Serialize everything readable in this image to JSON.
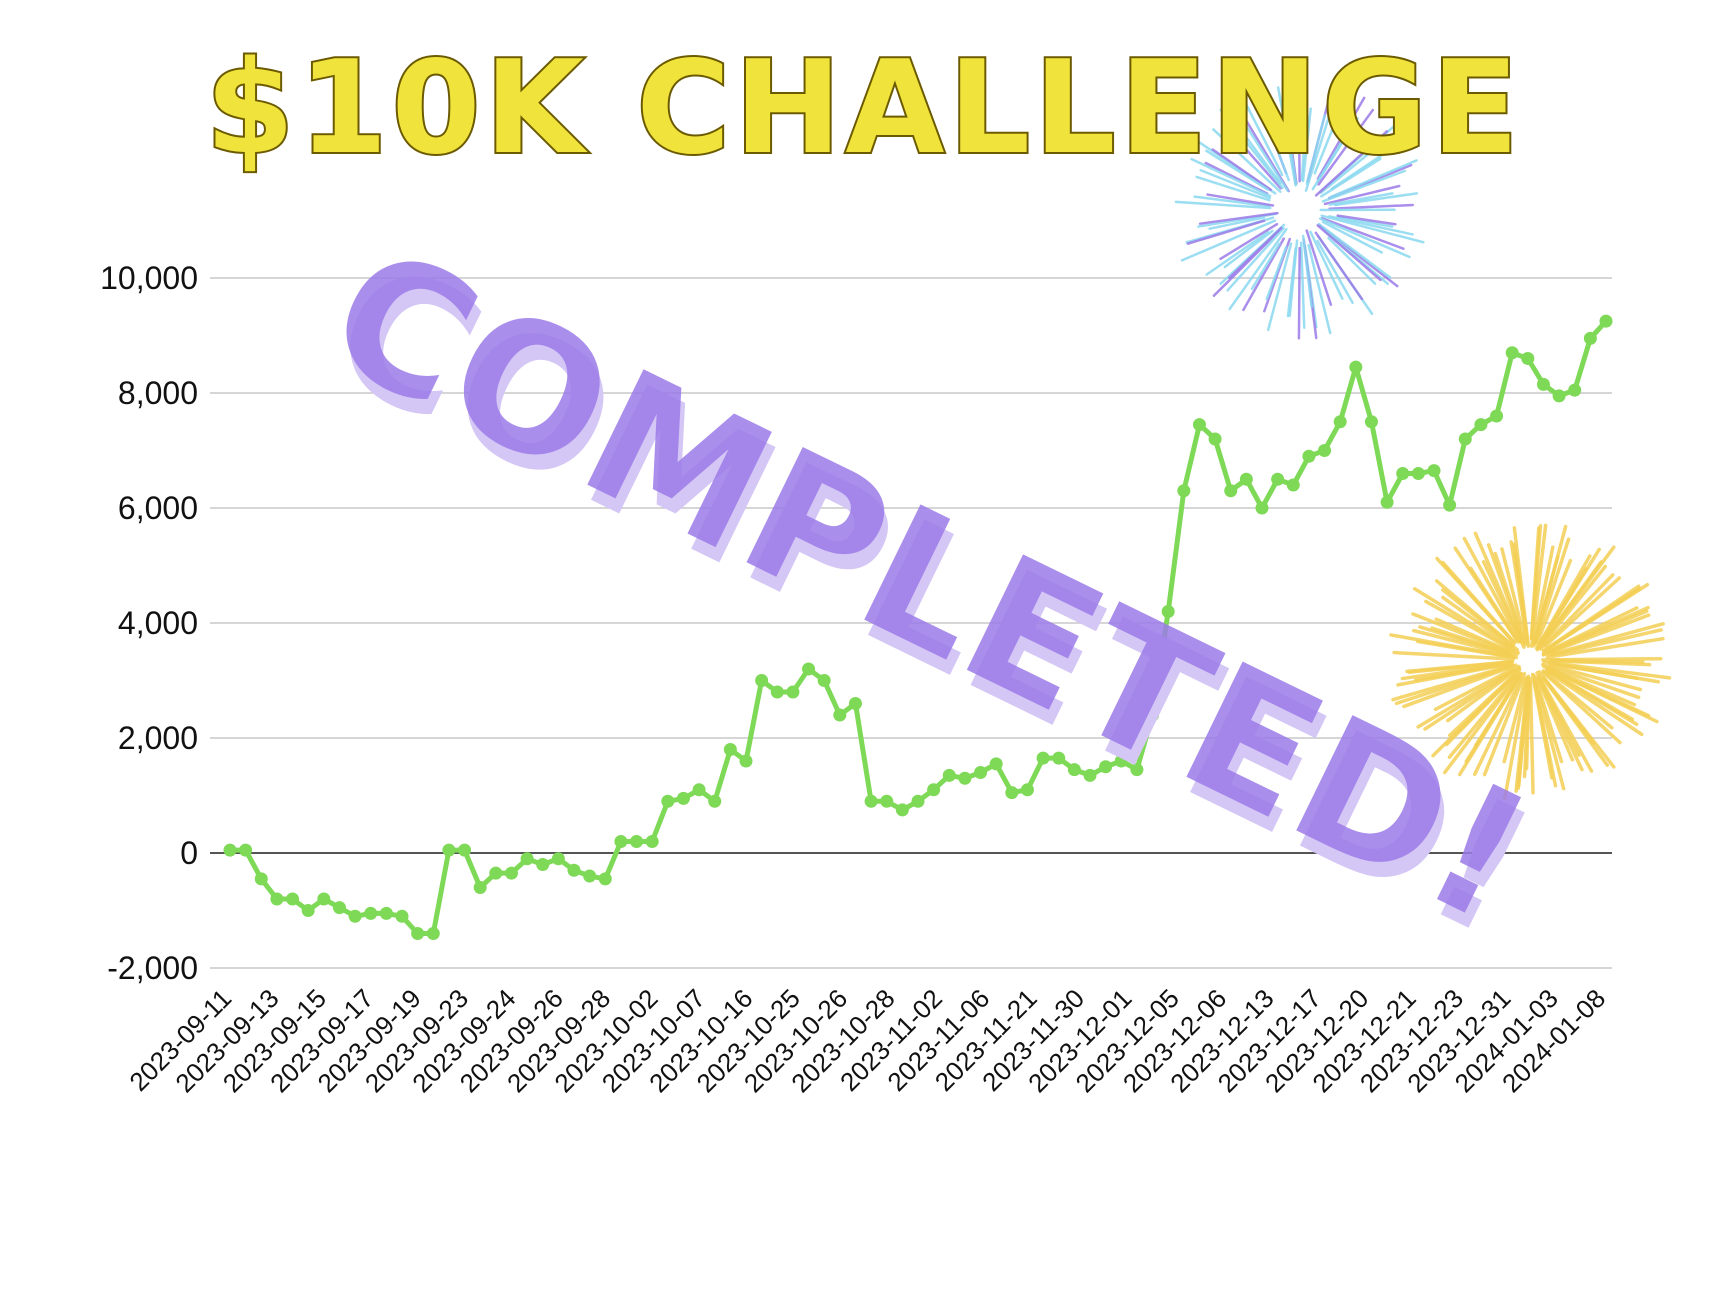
{
  "title": "$10K CHALLENGE",
  "stamp": "COMPLETED!",
  "colors": {
    "title_fill": "#f0e43c",
    "title_stroke": "#6b5a00",
    "line": "#7ed957",
    "stamp": "#9b7ae8",
    "stamp_shadow": "#d4c6f5",
    "grid": "#c8c8c8",
    "zero_line": "#555555",
    "firework_blue": "#8ad8f0",
    "firework_purple": "#9b7ae8",
    "firework_yellow": "#f3cf55"
  },
  "chart_data": {
    "type": "line",
    "title": "$10K CHALLENGE",
    "xlabel": "",
    "ylabel": "",
    "ylim": [
      -2000,
      10000
    ],
    "yticks": [
      -2000,
      0,
      2000,
      4000,
      6000,
      8000,
      10000
    ],
    "ytick_labels": [
      "-2,000",
      "0",
      "2,000",
      "4,000",
      "6,000",
      "8,000",
      "10,000"
    ],
    "grid": true,
    "legend": "none",
    "x_tick_labels": [
      "2023-09-11",
      "2023-09-13",
      "2023-09-15",
      "2023-09-17",
      "2023-09-19",
      "2023-09-23",
      "2023-09-24",
      "2023-09-26",
      "2023-09-28",
      "2023-10-02",
      "2023-10-07",
      "2023-10-16",
      "2023-10-25",
      "2023-10-26",
      "2023-10-28",
      "2023-11-02",
      "2023-11-06",
      "2023-11-21",
      "2023-11-30",
      "2023-12-01",
      "2023-12-05",
      "2023-12-06",
      "2023-12-13",
      "2023-12-17",
      "2023-12-20",
      "2023-12-21",
      "2023-12-23",
      "2023-12-31",
      "2024-01-03",
      "2024-01-08"
    ],
    "series": [
      {
        "values": [
          50,
          50,
          -450,
          -800,
          -800,
          -1000,
          -800,
          -950,
          -1100,
          -1050,
          -1050,
          -1100,
          -1400,
          -1400,
          50,
          50,
          -600,
          -350,
          -350,
          -100,
          -200,
          -100,
          -300,
          -400,
          -450,
          200,
          200,
          200,
          900,
          950,
          1100,
          900,
          1800,
          1600,
          3000,
          2800,
          2800,
          3200,
          3000,
          2400,
          2600,
          900,
          900,
          750,
          900,
          1100,
          1350,
          1300,
          1400,
          1550,
          1050,
          1100,
          1650,
          1650,
          1450,
          1350,
          1500,
          1600,
          1450,
          2400,
          4200,
          6300,
          7450,
          7200,
          6300,
          6500,
          6000,
          6500,
          6400,
          6900,
          7000,
          7500,
          8450,
          7500,
          6100,
          6600,
          6600,
          6650,
          6050,
          7200,
          7450,
          7600,
          8700,
          8600,
          8150,
          7950,
          8050,
          8950,
          9250
        ]
      }
    ]
  }
}
